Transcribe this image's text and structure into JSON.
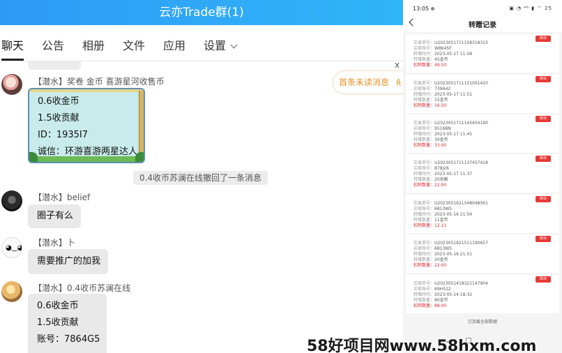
{
  "chat": {
    "title": "云亦Trade群(1)",
    "tabs": [
      {
        "label": "聊天"
      },
      {
        "label": "公告"
      },
      {
        "label": "相册"
      },
      {
        "label": "文件"
      },
      {
        "label": "应用"
      },
      {
        "label": "设置"
      }
    ],
    "close_glyph": "x",
    "unread_label": "首条未读消息",
    "unread_arrow": "≫",
    "system_notice": "0.4收币苏澜在线撤回了一条消息",
    "messages": [
      {
        "sender": "【潜水】奖卷 金币 喜游星河收售币",
        "lines": [
          "0.6收金币",
          "1.5收贡献",
          "ID：1935I7",
          "诚信：环游喜游两星达人"
        ]
      },
      {
        "sender": "【潜水】belief",
        "lines": [
          "圈子有么"
        ]
      },
      {
        "sender": "【潜水】卜",
        "lines": [
          "需要推广的加我"
        ]
      },
      {
        "sender": "【潜水】0.4收币苏澜在线",
        "lines": [
          "0.6收金币",
          "1.5收贡献",
          "账号：7864G5"
        ]
      }
    ]
  },
  "phone": {
    "status_time": "13:05",
    "status_icons": "▣ ◔ ⁴⁶ ▮ ⌔ 25",
    "title": "转赠记录",
    "labels": {
      "tx": "交易单号：",
      "buyer": "买家账号：",
      "time": "转赠时间：",
      "qty": "转赠数量：",
      "deduct": "扣除数量："
    },
    "tag": "转出",
    "records": [
      {
        "tx": "U2023051711158318315",
        "buyer": "W8645F",
        "time": "2023-05-17 11:58",
        "qty": "45金币",
        "deduct": "49.50"
      },
      {
        "tx": "U2023051711151001420",
        "buyer": "739A42",
        "time": "2023-05-17 11:51",
        "qty": "15金币",
        "deduct": "16.50"
      },
      {
        "tx": "U2023051711145454190",
        "buyer": "95168N",
        "time": "2023-05-17 11:45",
        "qty": "30金币",
        "deduct": "33.00"
      },
      {
        "tx": "U2023051711137457418",
        "buyer": "878J26",
        "time": "2023-05-17 11:37",
        "qty": "20贡献",
        "deduct": "22.00"
      },
      {
        "tx": "U2023051621548048561",
        "buyer": "6813W5",
        "time": "2023-05-16 21:54",
        "qty": "11金币",
        "deduct": "12.11"
      },
      {
        "tx": "U2023051621511190657",
        "buyer": "6813W5",
        "time": "2023-05-16 21:51",
        "qty": "20金币",
        "deduct": "22.00"
      },
      {
        "tx": "U2023051418321147904",
        "buyer": "69H522",
        "time": "2023-05-14 18:32",
        "qty": "80金币",
        "deduct": "88.00"
      }
    ],
    "loaded_all": "已加载全部数据"
  },
  "watermark": "58好项目网www.58hxm.com",
  "colors": {
    "header_blue": "#2f9af5",
    "unread_orange": "#e8912b",
    "tag_red": "#e53935",
    "deduct_red": "#d9262b"
  }
}
